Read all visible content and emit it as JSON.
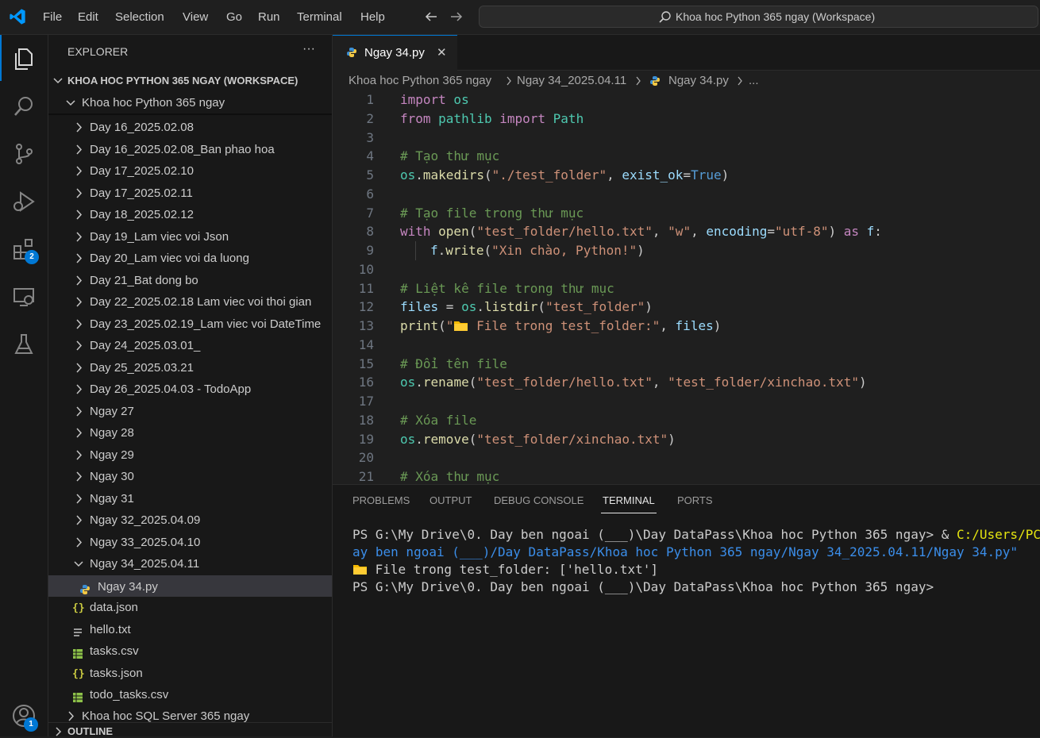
{
  "menu": [
    "File",
    "Edit",
    "Selection",
    "View",
    "Go",
    "Run",
    "Terminal",
    "Help"
  ],
  "search": {
    "text": "Khoa hoc Python 365 ngay (Workspace)"
  },
  "activity": {
    "extensions_badge": "2",
    "accounts_badge": "1"
  },
  "explorer": {
    "title": "EXPLORER",
    "more": "···",
    "workspace_title": "KHOA HOC PYTHON 365 NGAY (WORKSPACE)",
    "root_folder": "Khoa hoc Python 365 ngay",
    "items": [
      "Day 16_2025.02.08",
      "Day 16_2025.02.08_Ban phao hoa",
      "Day 17_2025.02.10",
      "Day 17_2025.02.11",
      "Day 18_2025.02.12",
      "Day 19_Lam viec voi Json",
      "Day 20_Lam viec voi da luong",
      "Day 21_Bat dong bo",
      "Day 22_2025.02.18 Lam viec voi thoi gian",
      "Day 23_2025.02.19_Lam viec voi DateTime",
      "Day 24_2025.03.01_",
      "Day 25_2025.03.21",
      "Day 26_2025.04.03 - TodoApp",
      "Ngay 27",
      "Ngay 28",
      "Ngay 29",
      "Ngay 30",
      "Ngay 31",
      "Ngay 32_2025.04.09",
      "Ngay 33_2025.04.10",
      "Ngay 34_2025.04.11"
    ],
    "active_file": "Ngay 34.py",
    "files": [
      {
        "name": "data.json",
        "icon": "json-icon"
      },
      {
        "name": "hello.txt",
        "icon": "text-file-icon"
      },
      {
        "name": "tasks.csv",
        "icon": "csv-icon"
      },
      {
        "name": "tasks.json",
        "icon": "json-icon"
      },
      {
        "name": "todo_tasks.csv",
        "icon": "csv-icon"
      }
    ],
    "other_folder": "Khoa hoc SQL Server 365 ngay",
    "outline": "OUTLINE"
  },
  "tab": {
    "label": "Ngay 34.py",
    "close": "✕"
  },
  "breadcrumb": {
    "p1": "Khoa hoc Python 365 ngay",
    "p2": "Ngay 34_2025.04.11",
    "p3": "Ngay 34.py",
    "p4": "..."
  },
  "code_lines": [
    "1",
    "2",
    "3",
    "4",
    "5",
    "6",
    "7",
    "8",
    "9",
    "10",
    "11",
    "12",
    "13",
    "14",
    "15",
    "16",
    "17",
    "18",
    "19",
    "20",
    "21"
  ],
  "code": {
    "l1a": "import",
    "l1b": " os",
    "l2a": "from",
    "l2b": " pathlib ",
    "l2c": "import",
    "l2d": " Path",
    "l4": "# Tạo thư mục",
    "l5a": "os",
    "l5b": ".",
    "l5c": "makedirs",
    "l5d": "(",
    "l5e": "\"./test_folder\"",
    "l5f": ", ",
    "l5g": "exist_ok",
    "l5h": "=",
    "l5i": "True",
    "l5j": ")",
    "l7": "# Tạo file trong thư mục",
    "l8a": "with",
    "l8b": " open",
    "l8c": "(",
    "l8d": "\"test_folder/hello.txt\"",
    "l8e": ", ",
    "l8f": "\"w\"",
    "l8g": ", ",
    "l8h": "encoding",
    "l8i": "=",
    "l8j": "\"utf-8\"",
    "l8k": ") ",
    "l8l": "as",
    "l8m": " f",
    "l8n": ":",
    "l9a": "f",
    "l9b": ".",
    "l9c": "write",
    "l9d": "(",
    "l9e": "\"Xin chào, Python!\"",
    "l9f": ")",
    "l11": "# Liệt kê file trong thư mục",
    "l12a": "files",
    "l12b": " = ",
    "l12c": "os",
    "l12d": ".",
    "l12e": "listdir",
    "l12f": "(",
    "l12g": "\"test_folder\"",
    "l12h": ")",
    "l13a": "print",
    "l13b": "(",
    "l13c": "\"",
    "l13d": "📁",
    "l13e": " File trong test_folder:\"",
    "l13f": ", ",
    "l13g": "files",
    "l13h": ")",
    "l15": "# Đổi tên file",
    "l16a": "os",
    "l16b": ".",
    "l16c": "rename",
    "l16d": "(",
    "l16e": "\"test_folder/hello.txt\"",
    "l16f": ", ",
    "l16g": "\"test_folder/xinchao.txt\"",
    "l16h": ")",
    "l18": "# Xóa file",
    "l19a": "os",
    "l19b": ".",
    "l19c": "remove",
    "l19d": "(",
    "l19e": "\"test_folder/xinchao.txt\"",
    "l19f": ")",
    "l21": "# Xóa thư mục"
  },
  "panel": {
    "tabs": [
      "PROBLEMS",
      "OUTPUT",
      "DEBUG CONSOLE",
      "TERMINAL",
      "PORTS"
    ],
    "active": "TERMINAL"
  },
  "terminal": {
    "l1a": "PS G:\\My Drive\\0. Day ben ngoai (___)\\Day DataPass\\Khoa hoc Python 365 ngay> & ",
    "l1b": "C:/Users/PCDTT/App",
    "l2": "ay ben ngoai (___)/Day DataPass/Khoa hoc Python 365 ngay/Ngay 34_2025.04.11/Ngay 34.py\"",
    "l3a": "📁",
    "l3b": " File trong test_folder: ['hello.txt']",
    "l4": "PS G:\\My Drive\\0. Day ben ngoai (___)\\Day DataPass\\Khoa hoc Python 365 ngay>"
  },
  "colors": {
    "accent": "#0078d4",
    "bg": "#1f1f1f",
    "sidebar": "#181818",
    "selected": "#37373d"
  }
}
